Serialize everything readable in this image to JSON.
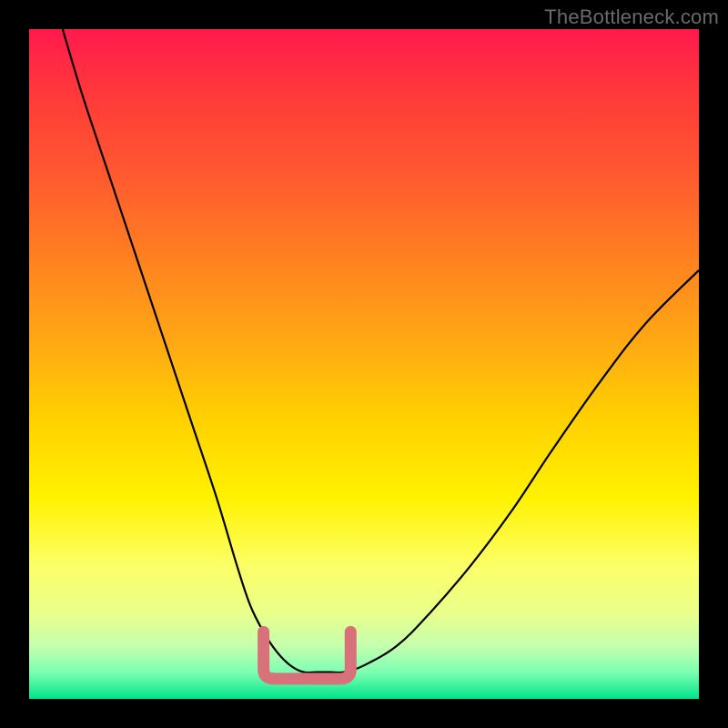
{
  "watermark": "TheBottleneck.com",
  "colors": {
    "background": "#000000",
    "curve_stroke": "#000000",
    "optimal_stroke": "#d9717a",
    "gradient_top": "#ff1a4d",
    "gradient_bottom": "#00e58a"
  },
  "chart_data": {
    "type": "line",
    "title": "",
    "xlabel": "",
    "ylabel": "",
    "xlim": [
      0,
      100
    ],
    "ylim": [
      0,
      100
    ],
    "grid": false,
    "legend": false,
    "series": [
      {
        "name": "bottleneck-curve",
        "x": [
          5,
          8,
          12,
          16,
          20,
          24,
          28,
          31,
          33,
          35,
          37,
          39,
          41,
          43,
          45,
          47,
          50,
          55,
          60,
          66,
          72,
          78,
          85,
          92,
          100
        ],
        "y": [
          100,
          90,
          78,
          66,
          54,
          42,
          30,
          20,
          14,
          10,
          7,
          5,
          4,
          4,
          4,
          4,
          5,
          8,
          13,
          20,
          28,
          37,
          47,
          56,
          64
        ]
      }
    ],
    "annotations": [
      {
        "name": "optimal-range",
        "type": "u-shape-highlight",
        "x_range": [
          35,
          48
        ],
        "y_floor": 3,
        "color": "#d9717a"
      }
    ]
  }
}
